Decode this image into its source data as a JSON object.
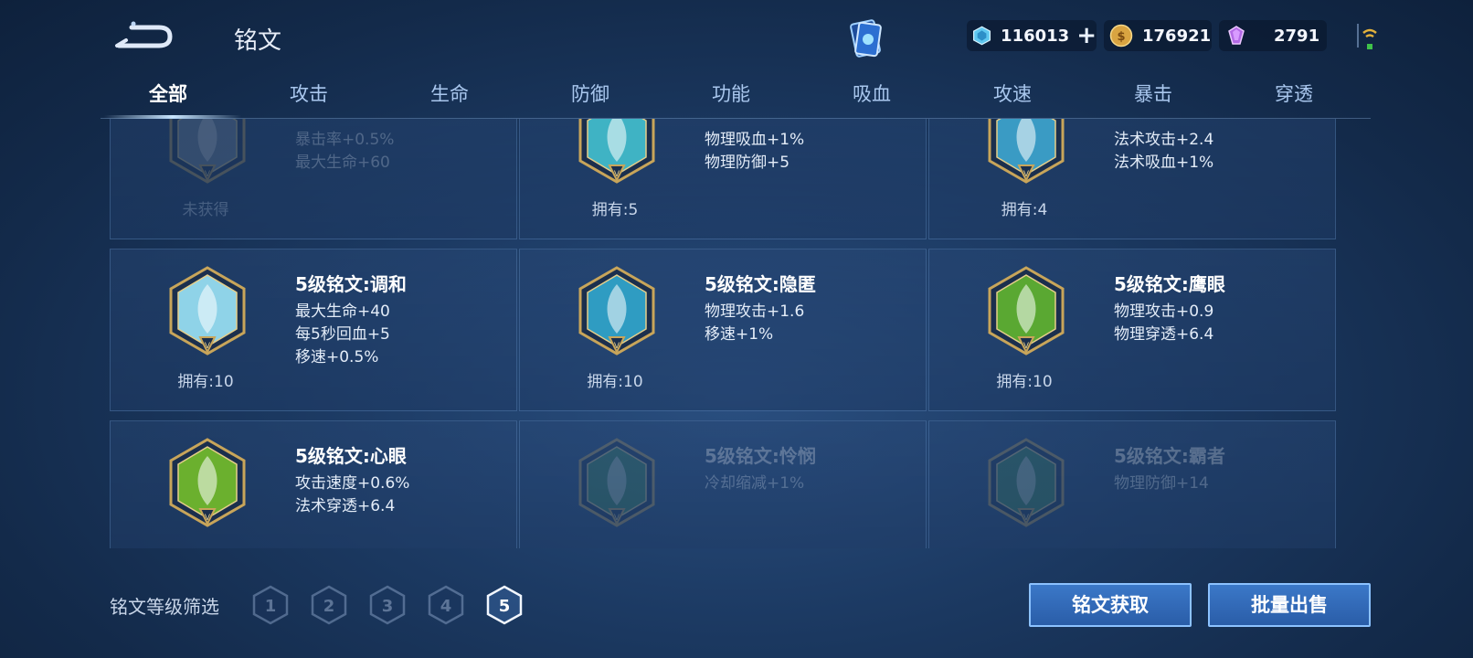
{
  "header": {
    "title": "铭文",
    "currencies": [
      {
        "icon": "diamond-coupon-icon",
        "value": "116013"
      },
      {
        "icon": "gold-coin-icon",
        "value": "176921"
      },
      {
        "icon": "crystal-icon",
        "value": "2791"
      }
    ]
  },
  "tabs": [
    {
      "label": "全部",
      "active": true
    },
    {
      "label": "攻击"
    },
    {
      "label": "生命"
    },
    {
      "label": "防御"
    },
    {
      "label": "功能"
    },
    {
      "label": "吸血"
    },
    {
      "label": "攻速"
    },
    {
      "label": "暴击"
    },
    {
      "label": "穿透"
    }
  ],
  "inscriptions": [
    {
      "name": "",
      "stats": [
        "暴击率+0.5%",
        "最大生命+60"
      ],
      "owned": "未获得",
      "color": "#7a8ba0",
      "dim": true
    },
    {
      "name": "",
      "stats": [
        "物理吸血+1%",
        "物理防御+5"
      ],
      "owned": "拥有:5",
      "color": "#3fb3c4"
    },
    {
      "name": "",
      "stats": [
        "法术攻击+2.4",
        "法术吸血+1%"
      ],
      "owned": "拥有:4",
      "color": "#3a9bc4"
    },
    {
      "name": "5级铭文:调和",
      "stats": [
        "最大生命+40",
        "每5秒回血+5",
        "移速+0.5%"
      ],
      "owned": "拥有:10",
      "color": "#8fd3e8"
    },
    {
      "name": "5级铭文:隐匿",
      "stats": [
        "物理攻击+1.6",
        "移速+1%"
      ],
      "owned": "拥有:10",
      "color": "#2f9cc2"
    },
    {
      "name": "5级铭文:鹰眼",
      "stats": [
        "物理攻击+0.9",
        "物理穿透+6.4"
      ],
      "owned": "拥有:10",
      "color": "#5aa832"
    },
    {
      "name": "5级铭文:心眼",
      "stats": [
        "攻击速度+0.6%",
        "法术穿透+6.4"
      ],
      "owned": "",
      "color": "#6bb02e"
    },
    {
      "name": "5级铭文:怜悯",
      "stats": [
        "冷却缩减+1%"
      ],
      "owned": "",
      "color": "#3d8a5a",
      "dim": true
    },
    {
      "name": "5级铭文:霸者",
      "stats": [
        "物理防御+14"
      ],
      "owned": "",
      "color": "#3d8a5a",
      "dim": true
    }
  ],
  "filter": {
    "label": "铭文等级筛选",
    "levels": [
      "1",
      "2",
      "3",
      "4",
      "5"
    ],
    "selected": "5"
  },
  "actions": {
    "obtain_label": "铭文获取",
    "sell_label": "批量出售"
  }
}
